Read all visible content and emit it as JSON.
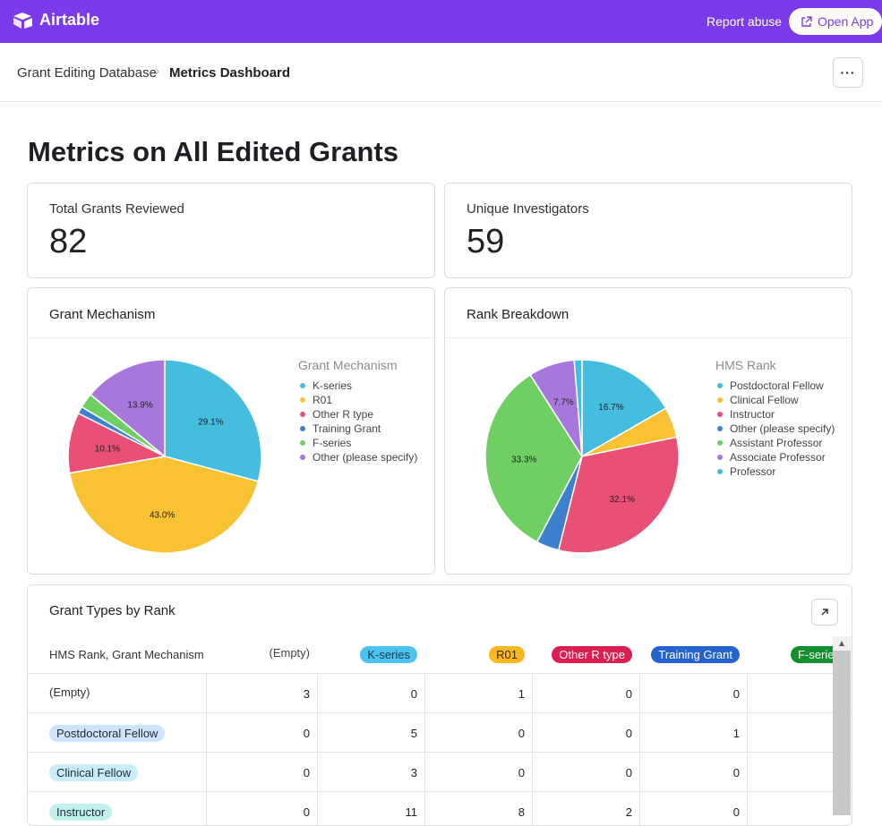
{
  "topbar": {
    "brand": "Airtable",
    "report_label": "Report abuse",
    "open_app_label": "Open App"
  },
  "breadcrumb": {
    "base": "Grant Editing Database",
    "current": "Metrics Dashboard",
    "more_label": "···"
  },
  "page": {
    "title": "Metrics on All Edited Grants"
  },
  "stats": [
    {
      "label": "Total Grants Reviewed",
      "value": "82"
    },
    {
      "label": "Unique Investigators",
      "value": "59"
    }
  ],
  "charts": {
    "mechanism": {
      "title": "Grant Mechanism",
      "legend_title": "Grant Mechanism",
      "legend": [
        "K-series",
        "R01",
        "Other R type",
        "Training Grant",
        "F-series",
        "Other (please specify)"
      ]
    },
    "rank": {
      "title": "Rank Breakdown",
      "legend_title": "HMS Rank",
      "legend": [
        "Postdoctoral Fellow",
        "Clinical Fellow",
        "Instructor",
        "Other (please specify)",
        "Assistant Professor",
        "Associate Professor",
        "Professor"
      ]
    }
  },
  "colors": {
    "brand": "#7c3aed",
    "k_series": "#45bddf",
    "r01": "#f8c233",
    "other_r": "#ea4f75",
    "training": "#3f7fcf",
    "f_series": "#6fcf62",
    "other_specify": "#a877dc",
    "professor": "#45bddf"
  },
  "chart_data": [
    {
      "type": "pie",
      "title": "Grant Mechanism",
      "labels": [
        "K-series",
        "R01",
        "Other R type",
        "Training Grant",
        "F-series",
        "Other (please specify)"
      ],
      "values": [
        29.1,
        43.0,
        10.1,
        1.2,
        2.5,
        13.9
      ],
      "value_labels": [
        "29.1%",
        "43.0%",
        "10.1%",
        "",
        "",
        "13.9%"
      ],
      "colors": [
        "#45bddf",
        "#f8c233",
        "#ea4f75",
        "#3f7fcf",
        "#6fcf62",
        "#a877dc"
      ]
    },
    {
      "type": "pie",
      "title": "Rank Breakdown",
      "labels": [
        "Postdoctoral Fellow",
        "Clinical Fellow",
        "Instructor",
        "Other (please specify)",
        "Assistant Professor",
        "Associate Professor",
        "Professor"
      ],
      "values": [
        16.7,
        5.1,
        32.1,
        3.8,
        33.3,
        7.7,
        1.3
      ],
      "value_labels": [
        "16.7%",
        "",
        "32.1%",
        "",
        "33.3%",
        "7.7%",
        ""
      ],
      "colors": [
        "#45bddf",
        "#f8c233",
        "#ea4f75",
        "#3f7fcf",
        "#6fcf62",
        "#a877dc",
        "#45bddf"
      ]
    }
  ],
  "table": {
    "title": "Grant Types by Rank",
    "corner_label": "HMS Rank, Grant Mechanism",
    "columns": [
      {
        "label": "(Empty)",
        "pill": false,
        "bg": "",
        "fg": "#444444"
      },
      {
        "label": "K-series",
        "pill": true,
        "bg": "#4cc3ee",
        "fg": "#1a3a4a"
      },
      {
        "label": "R01",
        "pill": true,
        "bg": "#f6b81f",
        "fg": "#3b2b00"
      },
      {
        "label": "Other R type",
        "pill": true,
        "bg": "#dc1e52",
        "fg": "#ffffff"
      },
      {
        "label": "Training Grant",
        "pill": true,
        "bg": "#2563d0",
        "fg": "#ffffff"
      },
      {
        "label": "F-series",
        "pill": true,
        "bg": "#14912e",
        "fg": "#ffffff"
      }
    ],
    "rows": [
      {
        "label": "(Empty)",
        "pill": false,
        "bg": "",
        "values": [
          "3",
          "0",
          "1",
          "0",
          "0"
        ]
      },
      {
        "label": "Postdoctoral Fellow",
        "pill": true,
        "bg": "#cfe3fb",
        "values": [
          "0",
          "5",
          "0",
          "0",
          "1"
        ]
      },
      {
        "label": "Clinical Fellow",
        "pill": true,
        "bg": "#c9eefa",
        "values": [
          "0",
          "3",
          "0",
          "0",
          "0"
        ]
      },
      {
        "label": "Instructor",
        "pill": true,
        "bg": "#c3f0ea",
        "values": [
          "0",
          "11",
          "8",
          "2",
          "0"
        ]
      }
    ]
  }
}
